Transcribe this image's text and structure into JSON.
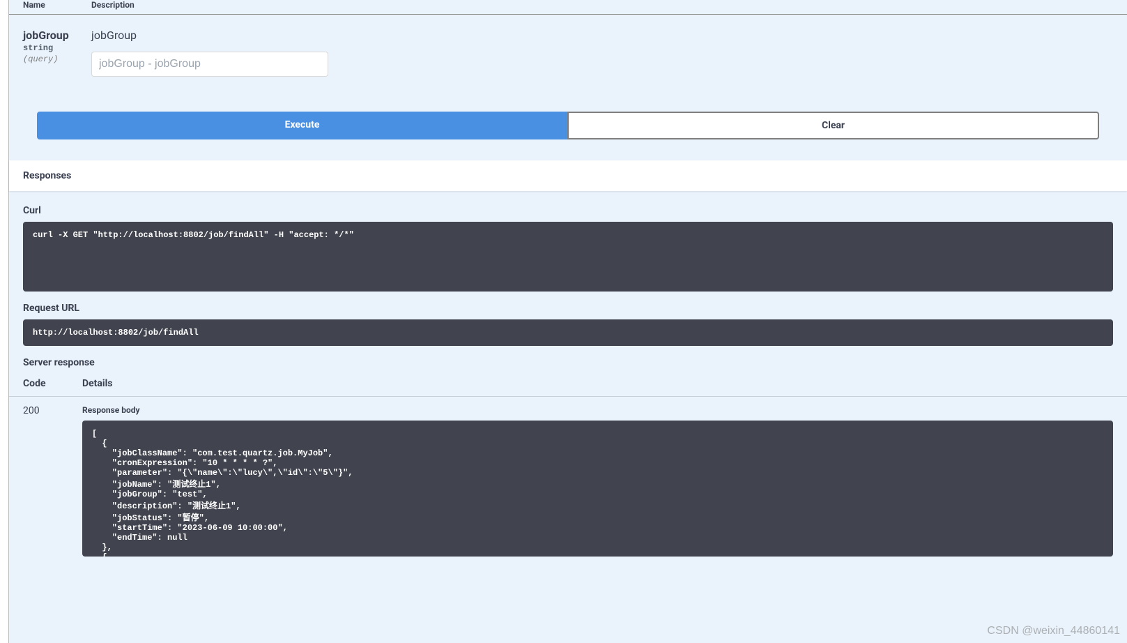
{
  "params_table": {
    "header_name": "Name",
    "header_desc": "Description",
    "rows": [
      {
        "name": "jobGroup",
        "type": "string",
        "in": "(query)",
        "description": "jobGroup",
        "placeholder": "jobGroup - jobGroup"
      }
    ]
  },
  "buttons": {
    "execute": "Execute",
    "clear": "Clear"
  },
  "responses": {
    "heading": "Responses",
    "curl_label": "Curl",
    "curl_cmd": "curl -X GET \"http://localhost:8802/job/findAll\" -H \"accept: */*\"",
    "request_url_label": "Request URL",
    "request_url": "http://localhost:8802/job/findAll",
    "server_response_label": "Server response",
    "code_header": "Code",
    "details_header": "Details",
    "status_code": "200",
    "response_body_label": "Response body",
    "response_body": "[\n  {\n    \"jobClassName\": \"com.test.quartz.job.MyJob\",\n    \"cronExpression\": \"10 * * * * ?\",\n    \"parameter\": \"{\\\"name\\\":\\\"lucy\\\",\\\"id\\\":\\\"5\\\"}\",\n    \"jobName\": \"测试终止1\",\n    \"jobGroup\": \"test\",\n    \"description\": \"测试终止1\",\n    \"jobStatus\": \"暂停\",\n    \"startTime\": \"2023-06-09 10:00:00\",\n    \"endTime\": null\n  },\n  {"
  },
  "watermark": "CSDN @weixin_44860141"
}
